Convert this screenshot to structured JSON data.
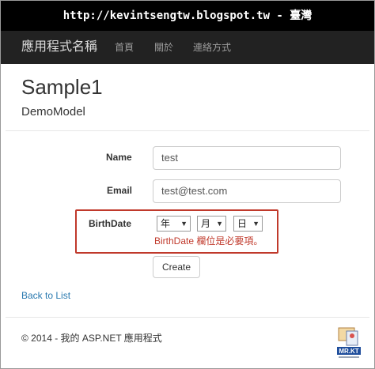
{
  "banner": {
    "text": "http://kevintsengtw.blogspot.tw - 臺灣"
  },
  "navbar": {
    "brand": "應用程式名稱",
    "links": [
      "首頁",
      "關於",
      "連絡方式"
    ]
  },
  "page": {
    "title": "Sample1",
    "subtitle": "DemoModel"
  },
  "form": {
    "name_label": "Name",
    "name_value": "test",
    "email_label": "Email",
    "email_value": "test@test.com",
    "birthdate_label": "BirthDate",
    "year_select": "年",
    "month_select": "月",
    "day_select": "日",
    "error_message": "BirthDate 欄位是必要項。",
    "create_button": "Create"
  },
  "back_link": "Back to List",
  "footer": "© 2014 - 我的 ASP.NET 應用程式",
  "logo": {
    "text": "MR.KT",
    "icon": "mrkt-logo"
  },
  "colors": {
    "navbar": "#222222",
    "banner": "#000000",
    "error": "#c0392b",
    "link": "#2a7ab0",
    "highlight_border": "#c0392b"
  }
}
